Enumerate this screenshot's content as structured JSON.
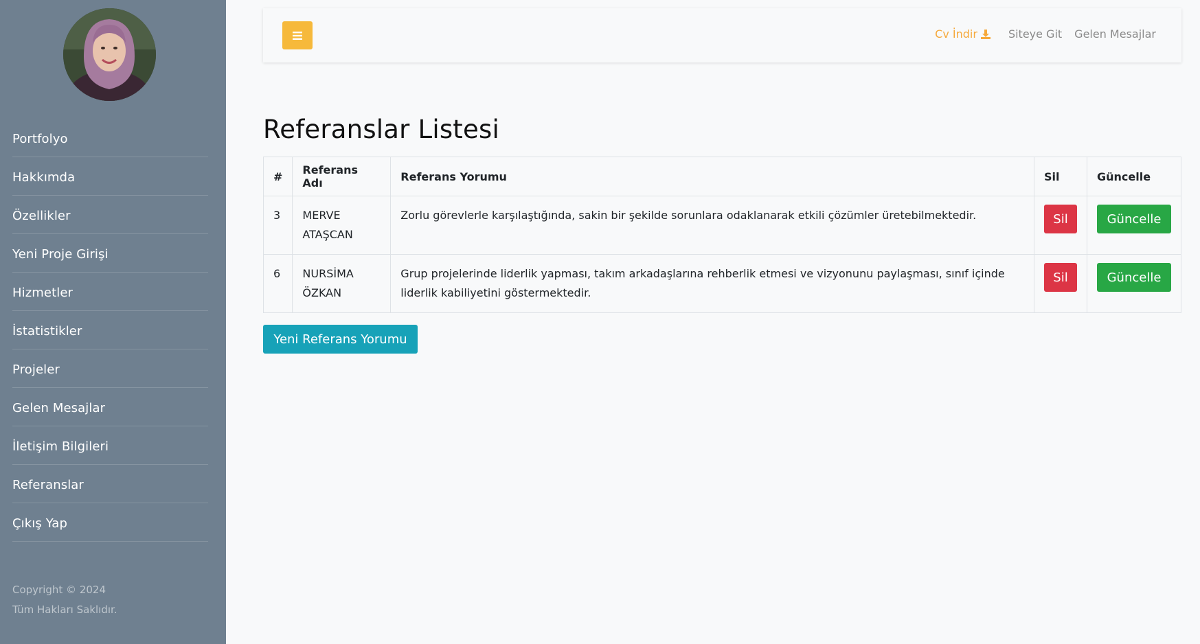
{
  "sidebar": {
    "items": [
      {
        "label": "Portfolyo"
      },
      {
        "label": "Hakkımda"
      },
      {
        "label": "Özellikler"
      },
      {
        "label": "Yeni Proje Girişi"
      },
      {
        "label": "Hizmetler"
      },
      {
        "label": "İstatistikler"
      },
      {
        "label": "Projeler"
      },
      {
        "label": "Gelen Mesajlar"
      },
      {
        "label": "İletişim Bilgileri"
      },
      {
        "label": "Referanslar"
      },
      {
        "label": "Çıkış Yap"
      }
    ],
    "copyright_line1": "Copyright © 2024",
    "copyright_line2": "Tüm Hakları Saklıdır."
  },
  "topbar": {
    "toggle_icon": "hamburger-icon",
    "cv_label": "Cv İndir",
    "cv_icon": "download-icon",
    "site_label": "Siteye Git",
    "messages_label": "Gelen Mesajlar"
  },
  "main": {
    "title": "Referanslar Listesi",
    "table": {
      "headers": [
        "#",
        "Referans Adı",
        "Referans Yorumu",
        "Sil",
        "Güncelle"
      ],
      "rows": [
        {
          "id": "3",
          "name_line1": "MERVE",
          "name_line2": "ATAŞCAN",
          "comment": "Zorlu görevlerle karşılaştığında, sakin bir şekilde sorunlara odaklanarak etkili çözümler üretebilmektedir.",
          "delete_label": "Sil",
          "update_label": "Güncelle"
        },
        {
          "id": "6",
          "name_line1": "NURSİMA",
          "name_line2": "ÖZKAN",
          "comment": "Grup projelerinde liderlik yapması, takım arkadaşlarına rehberlik etmesi ve vizyonunu paylaşması, sınıf içinde liderlik kabiliyetini göstermektedir.",
          "delete_label": "Sil",
          "update_label": "Güncelle"
        }
      ]
    },
    "new_button_label": "Yeni Referans Yorumu"
  },
  "colors": {
    "sidebar_bg": "#6f8090",
    "accent": "#f6b93b",
    "danger": "#dc3545",
    "success": "#28a745",
    "info": "#17a2b8"
  }
}
